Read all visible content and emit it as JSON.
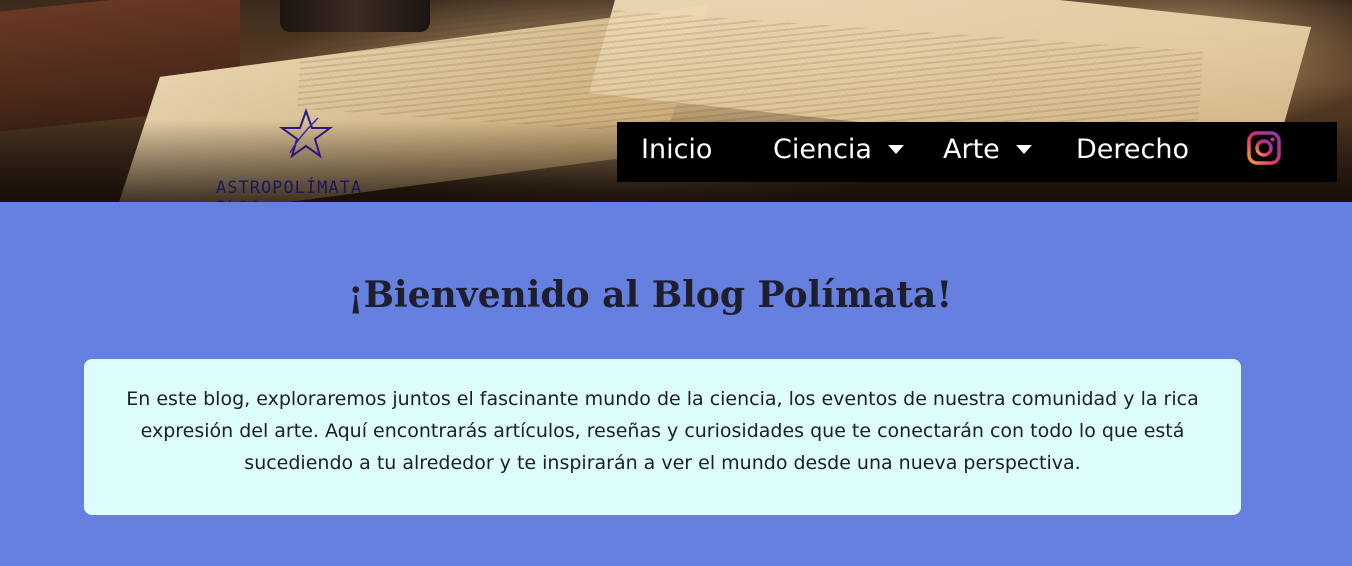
{
  "logo": {
    "text": "ASTROPOLÍMATA BLOG",
    "icon": "star-icon"
  },
  "nav": {
    "items": [
      {
        "label": "Inicio",
        "dropdown": false
      },
      {
        "label": "Ciencia",
        "dropdown": true
      },
      {
        "label": "Arte",
        "dropdown": true
      },
      {
        "label": "Derecho",
        "dropdown": false
      }
    ],
    "social_icon": "instagram-icon"
  },
  "main": {
    "title": "¡Bienvenido al Blog Polímata!",
    "intro": "En este blog, exploraremos juntos el fascinante mundo de la ciencia, los eventos de nuestra comunidad y la rica expresión del arte. Aquí encontrarás artículos, reseñas y curiosidades que te conectarán con todo lo que está sucediendo a tu alrededor y te inspirarán a ver el mundo desde una nueva perspectiva."
  },
  "colors": {
    "page_background": "#6680e0",
    "nav_background": "#000000",
    "card_background": "#dcfdfb"
  }
}
